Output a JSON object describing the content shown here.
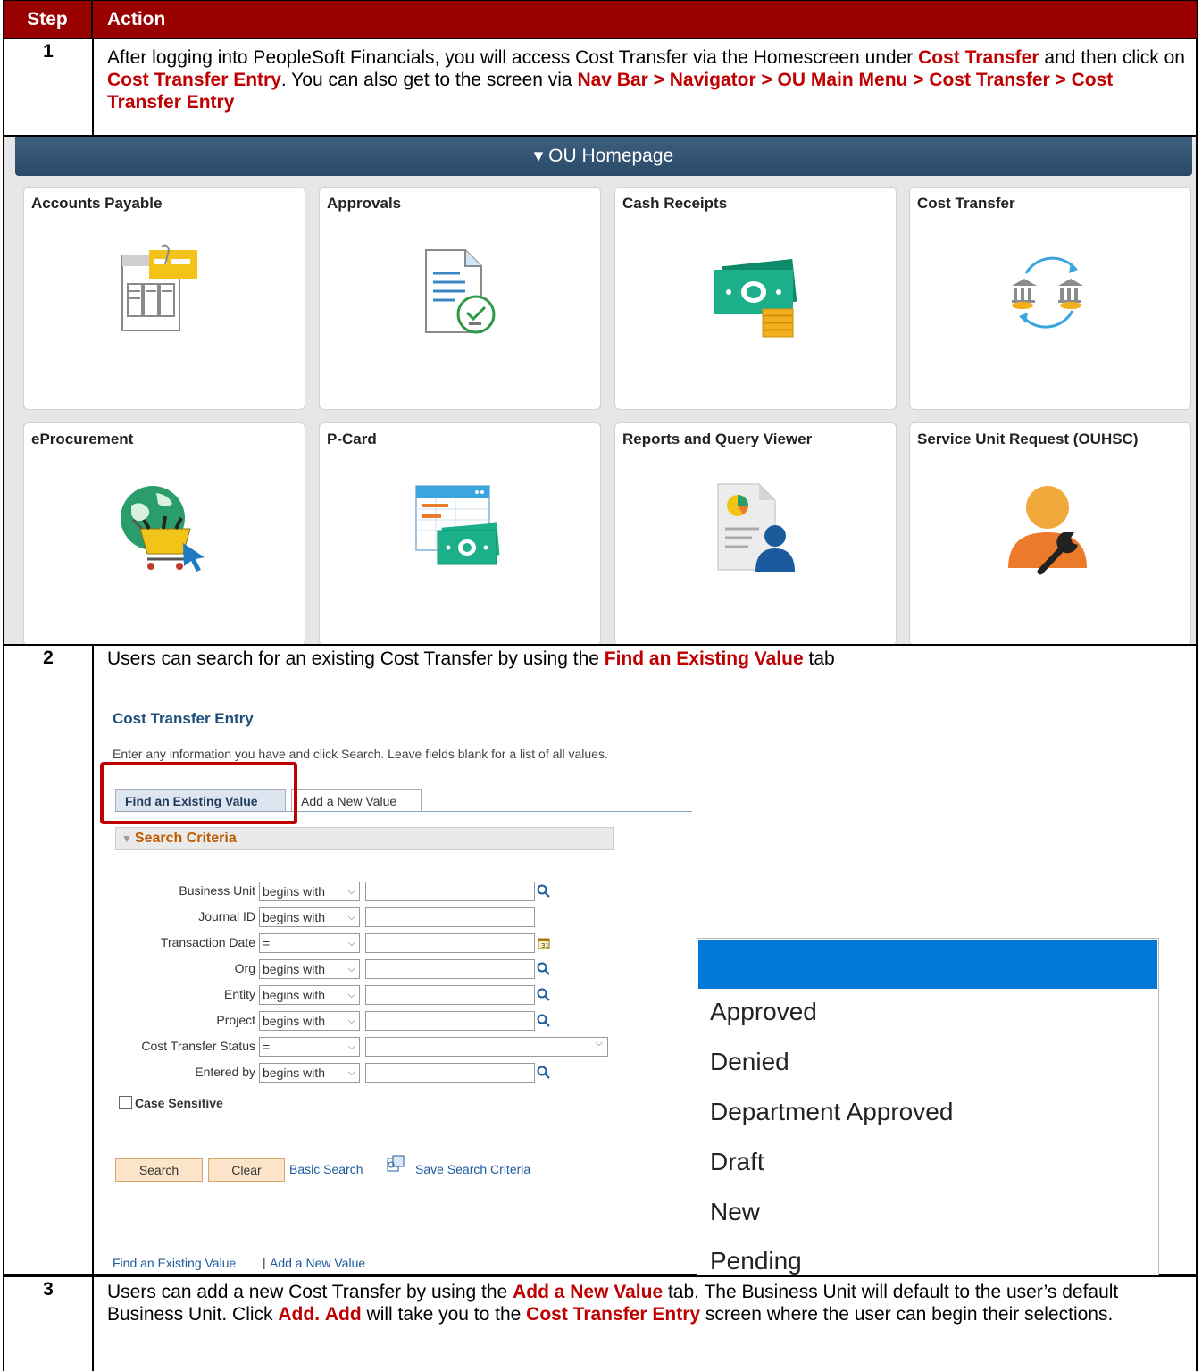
{
  "header": {
    "step": "Step",
    "action": "Action"
  },
  "step1": {
    "num": "1",
    "text_a": "After logging into PeopleSoft Financials, you will access Cost Transfer via the Homescreen under ",
    "hl_a": "Cost Transfer",
    "text_b": " and then click on ",
    "hl_b": "Cost Transfer Entry",
    "text_c": ".  You can also get to the screen via ",
    "hl_c": "Nav Bar > Navigator > OU Main Menu > Cost Transfer > Cost Transfer Entry"
  },
  "homepage": {
    "banner": "▾ OU Homepage",
    "tiles": [
      "Accounts Payable",
      "Approvals",
      "Cash Receipts",
      "Cost Transfer",
      "eProcurement",
      "P-Card",
      "Reports and Query Viewer",
      "Service Unit Request (OUHSC)"
    ]
  },
  "step2": {
    "num": "2",
    "text_a": "Users can search for an existing Cost Transfer by using the ",
    "hl_a": "Find an Existing Value",
    "text_b": " tab"
  },
  "search_page": {
    "title": "Cost Transfer Entry",
    "description": "Enter any information you have and click Search. Leave fields blank for a list of all values.",
    "tab_find": "Find an Existing Value",
    "tab_add": "Add a New Value",
    "section": "Search Criteria",
    "fields": {
      "business_unit": {
        "label": "Business Unit",
        "operator": "begins with"
      },
      "journal_id": {
        "label": "Journal ID",
        "operator": "begins with"
      },
      "transaction_date": {
        "label": "Transaction Date",
        "operator": "="
      },
      "org": {
        "label": "Org",
        "operator": "begins with"
      },
      "entity": {
        "label": "Entity",
        "operator": "begins with"
      },
      "project": {
        "label": "Project",
        "operator": "begins with"
      },
      "status": {
        "label": "Cost Transfer Status",
        "operator": "="
      },
      "entered_by": {
        "label": "Entered by",
        "operator": "begins with"
      }
    },
    "case_sensitive": "Case Sensitive",
    "search_button": "Search",
    "clear_button": "Clear",
    "basic_search": "Basic Search",
    "save_search": "Save Search Criteria",
    "footer_find": "Find an Existing Value",
    "footer_sep": "|",
    "footer_add": "Add a New Value"
  },
  "status_dropdown": [
    "Approved",
    "Denied",
    "Department Approved",
    "Draft",
    "New",
    "Pending"
  ],
  "step3": {
    "num": "3",
    "text_a": "Users can add a new Cost Transfer by using the ",
    "hl_a": "Add a New Value",
    "text_b": " tab.  The Business Unit will default to the user’s default Business Unit. Click ",
    "hl_b": "Add.",
    "text_c": " ",
    "hl_c": "Add",
    "text_d": " will take you to the ",
    "hl_d": "Cost Transfer Entry",
    "text_e": " screen where the user can begin their selections."
  },
  "colors": {
    "header_bg": "#990000",
    "highlight": "#c00000",
    "banner": "#2f4f6f",
    "selection": "#0078d7"
  }
}
